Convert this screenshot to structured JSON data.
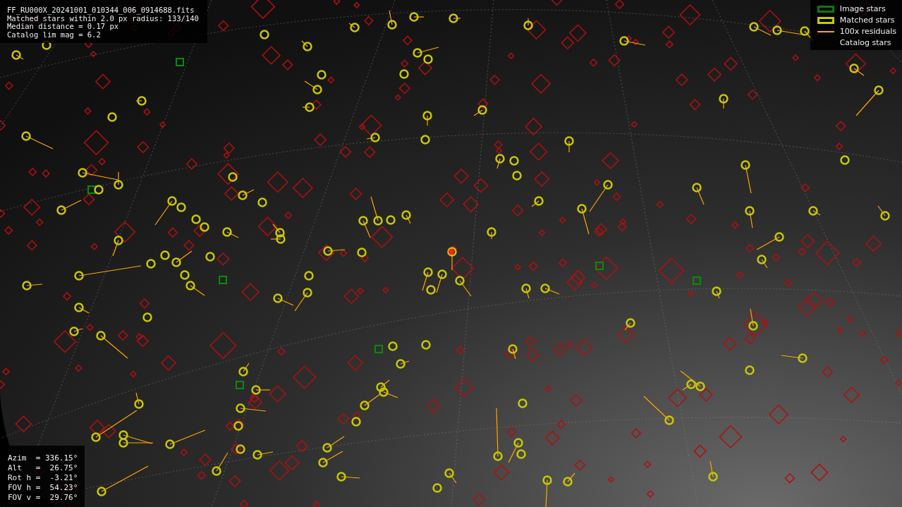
{
  "file_info": {
    "lines": [
      "FF_RU000X_20241001_010344_006_0914688.fits",
      "Matched stars within 2.0 px radius: 133/140",
      "Median distance = 0.17 px",
      "Catalog lim mag = 6.2"
    ]
  },
  "pointing_info": {
    "lines": [
      "Azim  = 336.15°",
      "Alt   =  26.75°",
      "Rot h =  -3.21°",
      "FOV h =  54.23°",
      "FOV v =  29.76°"
    ]
  },
  "legend": [
    {
      "kind": "box",
      "color": "#0a7a0a",
      "label": "Image stars"
    },
    {
      "kind": "box",
      "color": "#c8c800",
      "label": "Matched stars"
    },
    {
      "kind": "line",
      "color": "#ffa500",
      "label": "100x residuals"
    },
    {
      "kind": "none",
      "label": "Catalog stars"
    }
  ]
}
